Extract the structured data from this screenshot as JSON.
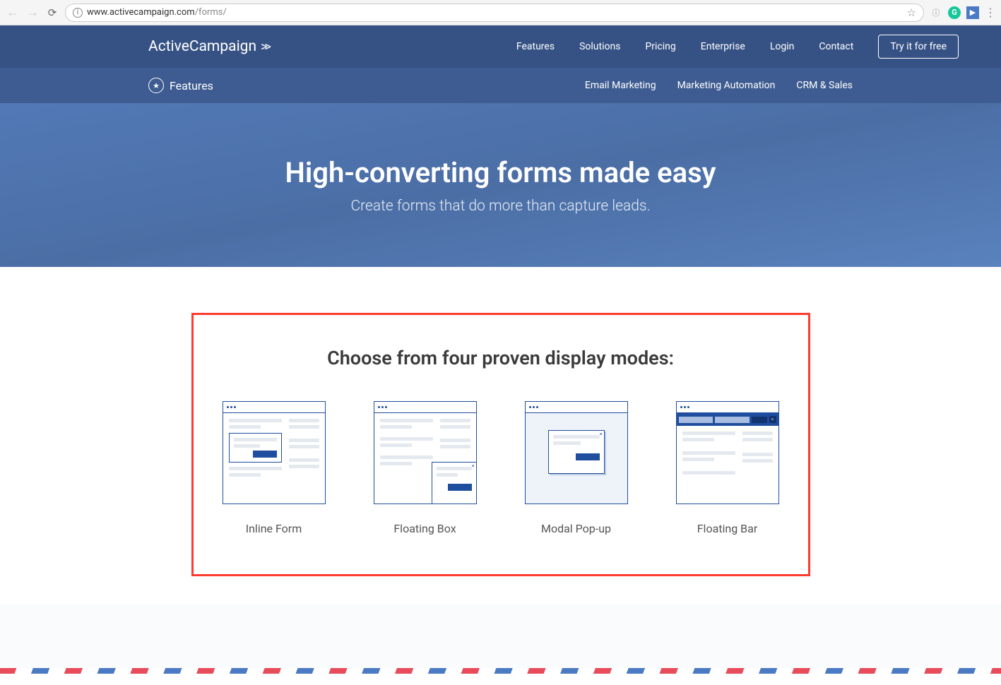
{
  "browser": {
    "url_host": "www.activecampaign.com",
    "url_path": "/forms/"
  },
  "nav": {
    "logo": "ActiveCampaign",
    "links": [
      "Features",
      "Solutions",
      "Pricing",
      "Enterprise",
      "Login",
      "Contact"
    ],
    "cta": "Try it for free"
  },
  "subnav": {
    "label": "Features",
    "links": [
      "Email Marketing",
      "Marketing Automation",
      "CRM & Sales"
    ]
  },
  "hero": {
    "title": "High-converting forms made easy",
    "subtitle": "Create forms that do more than capture leads."
  },
  "section": {
    "title": "Choose from four proven display modes:",
    "modes": [
      "Inline Form",
      "Floating Box",
      "Modal Pop-up",
      "Floating Bar"
    ]
  }
}
